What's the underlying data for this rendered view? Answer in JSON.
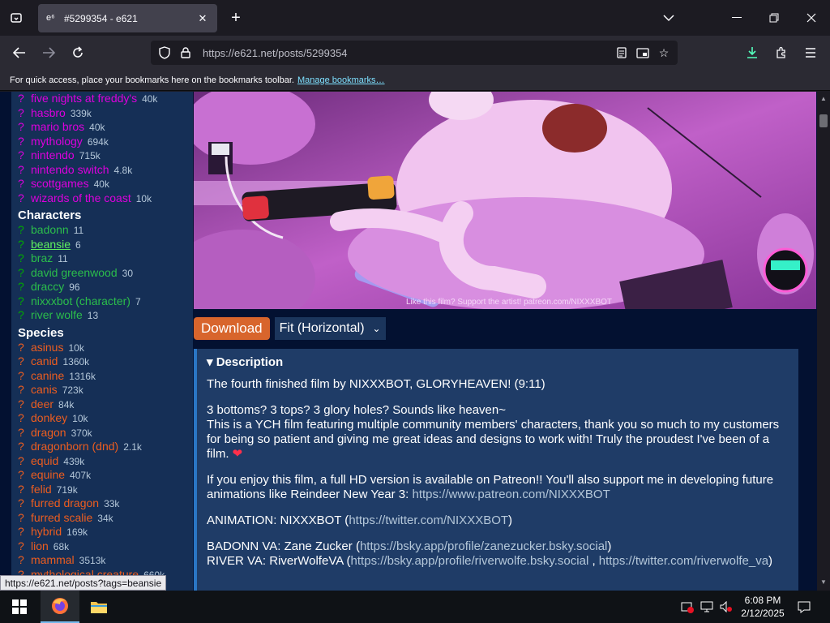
{
  "browser": {
    "tab_title": "#5299354 - e621",
    "url_host": "https://e621.net",
    "url_path": "/posts/5299354",
    "bookmarks_message": "For quick access, place your bookmarks here on the bookmarks toolbar.",
    "bookmarks_link": "Manage bookmarks…",
    "status_url": "https://e621.net/posts?tags=beansie"
  },
  "sidebar": {
    "copyrights": [
      {
        "name": "five nights at freddy's",
        "count": "40k"
      },
      {
        "name": "hasbro",
        "count": "339k"
      },
      {
        "name": "mario bros",
        "count": "40k"
      },
      {
        "name": "mythology",
        "count": "694k"
      },
      {
        "name": "nintendo",
        "count": "715k"
      },
      {
        "name": "nintendo switch",
        "count": "4.8k"
      },
      {
        "name": "scottgames",
        "count": "40k"
      },
      {
        "name": "wizards of the coast",
        "count": "10k"
      }
    ],
    "characters_title": "Characters",
    "characters": [
      {
        "name": "badonn",
        "count": "11"
      },
      {
        "name": "beansie",
        "count": "6"
      },
      {
        "name": "braz",
        "count": "11"
      },
      {
        "name": "david greenwood",
        "count": "30"
      },
      {
        "name": "draccy",
        "count": "96"
      },
      {
        "name": "nixxxbot (character)",
        "count": "7"
      },
      {
        "name": "river wolfe",
        "count": "13"
      }
    ],
    "species_title": "Species",
    "species": [
      {
        "name": "asinus",
        "count": "10k"
      },
      {
        "name": "canid",
        "count": "1360k"
      },
      {
        "name": "canine",
        "count": "1316k"
      },
      {
        "name": "canis",
        "count": "723k"
      },
      {
        "name": "deer",
        "count": "84k"
      },
      {
        "name": "donkey",
        "count": "10k"
      },
      {
        "name": "dragon",
        "count": "370k"
      },
      {
        "name": "dragonborn (dnd)",
        "count": "2.1k"
      },
      {
        "name": "equid",
        "count": "439k"
      },
      {
        "name": "equine",
        "count": "407k"
      },
      {
        "name": "felid",
        "count": "719k"
      },
      {
        "name": "furred dragon",
        "count": "33k"
      },
      {
        "name": "furred scalie",
        "count": "34k"
      },
      {
        "name": "hybrid",
        "count": "169k"
      },
      {
        "name": "lion",
        "count": "68k"
      },
      {
        "name": "mammal",
        "count": "3513k"
      },
      {
        "name": "mythological creature",
        "count": "660k"
      }
    ],
    "question_mark": "?"
  },
  "artwork": {
    "caption": "Like this film? Support the artist! patreon.com/NIXXXBOT",
    "watermark": "NIXXXBOT"
  },
  "controls": {
    "download_label": "Download",
    "fit_label": "Fit (Horizontal)"
  },
  "description": {
    "title": "Description",
    "p1": "The fourth finished film by NIXXXBOT, GLORYHEAVEN! (9:11)",
    "p2_line1": "3 bottoms? 3 tops? 3 glory holes? Sounds like heaven~",
    "p2_line2": "This is a YCH film featuring multiple community members' characters, thank you so much to my customers for being so patient and giving me great ideas and designs to work with! Truly the proudest I've been of a film.",
    "p3_text": "If you enjoy this film, a full HD version is available on Patreon!! You'll also support me in developing future animations like Reindeer New Year 3:",
    "p3_link": "https://www.patreon.com/NIXXXBOT",
    "p4_label": "ANIMATION: NIXXXBOT (",
    "p4_link": "https://twitter.com/NIXXXBOT",
    "p4_end": ")",
    "p5_label": "BADONN VA: Zane Zucker (",
    "p5_link": "https://bsky.app/profile/zanezucker.bsky.social",
    "p5_end": ")",
    "p6_label": "RIVER VA: RiverWolfeVA (",
    "p6_link1": "https://bsky.app/profile/riverwolfe.bsky.social",
    "p6_sep": " , ",
    "p6_link2": "https://twitter.com/riverwolfe_va",
    "p6_end": ")"
  },
  "taskbar": {
    "time": "6:08 PM",
    "date": "2/12/2025"
  },
  "colors": {
    "page_bg": "#031131",
    "sidebar_bg": "#152f56",
    "copyright_tag": "#dd00dd",
    "character_tag": "#2bbd4b",
    "species_tag": "#ed5d1f",
    "download_button": "#d8652c",
    "description_bg": "#1f3c67"
  }
}
